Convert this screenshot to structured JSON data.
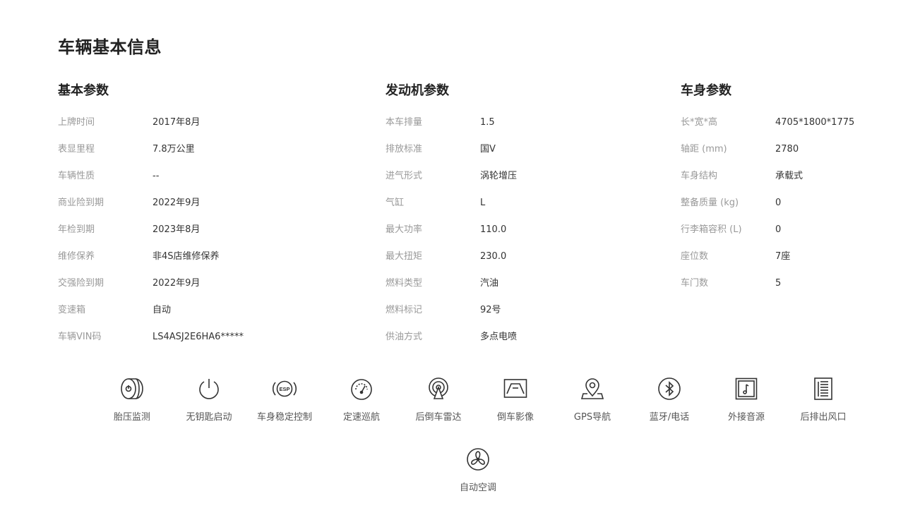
{
  "page": {
    "title": "车辆基本信息"
  },
  "sections": [
    {
      "title": "基本参数",
      "rows": [
        {
          "label": "上牌时间",
          "value": "2017年8月"
        },
        {
          "label": "表显里程",
          "value": "7.8万公里"
        },
        {
          "label": "车辆性质",
          "value": "--"
        },
        {
          "label": "商业险到期",
          "value": "2022年9月"
        },
        {
          "label": "年检到期",
          "value": "2023年8月"
        },
        {
          "label": "维修保养",
          "value": "非4S店维修保养"
        },
        {
          "label": "交强险到期",
          "value": "2022年9月"
        },
        {
          "label": "变速箱",
          "value": "自动"
        },
        {
          "label": "车辆VIN码",
          "value": "LS4ASJ2E6HA6*****"
        }
      ]
    },
    {
      "title": "发动机参数",
      "rows": [
        {
          "label": "本车排量",
          "value": "1.5"
        },
        {
          "label": "排放标准",
          "value": "国V"
        },
        {
          "label": "进气形式",
          "value": "涡轮增压"
        },
        {
          "label": "气缸",
          "value": "L"
        },
        {
          "label": "最大功率",
          "value": "110.0"
        },
        {
          "label": "最大扭矩",
          "value": "230.0"
        },
        {
          "label": "燃料类型",
          "value": "汽油"
        },
        {
          "label": "燃料标记",
          "value": "92号"
        },
        {
          "label": "供油方式",
          "value": "多点电喷"
        }
      ]
    },
    {
      "title": "车身参数",
      "rows": [
        {
          "label": "长*宽*高",
          "value": "4705*1800*1775"
        },
        {
          "label": "轴距 (mm)",
          "value": "2780"
        },
        {
          "label": "车身结构",
          "value": "承载式"
        },
        {
          "label": "整备质量 (kg)",
          "value": "0"
        },
        {
          "label": "行李箱容积 (L)",
          "value": "0"
        },
        {
          "label": "座位数",
          "value": "7座"
        },
        {
          "label": "车门数",
          "value": "5"
        }
      ]
    }
  ],
  "features": [
    {
      "label": "胎压监测",
      "icon": "tire-pressure-icon"
    },
    {
      "label": "无钥匙启动",
      "icon": "power-icon"
    },
    {
      "label": "车身稳定控制",
      "icon": "esp-icon"
    },
    {
      "label": "定速巡航",
      "icon": "cruise-gauge-icon"
    },
    {
      "label": "后倒车雷达",
      "icon": "radar-icon"
    },
    {
      "label": "倒车影像",
      "icon": "reverse-camera-icon"
    },
    {
      "label": "GPS导航",
      "icon": "gps-pin-icon"
    },
    {
      "label": "蓝牙/电话",
      "icon": "bluetooth-icon"
    },
    {
      "label": "外接音源",
      "icon": "music-note-icon"
    },
    {
      "label": "后排出风口",
      "icon": "air-vent-icon"
    },
    {
      "label": "自动空调",
      "icon": "fan-icon"
    }
  ],
  "icon_text": {
    "esp": "ESP"
  },
  "colors": {
    "title": "#222222",
    "label": "#999999",
    "value": "#333333",
    "icon": "#333333"
  }
}
